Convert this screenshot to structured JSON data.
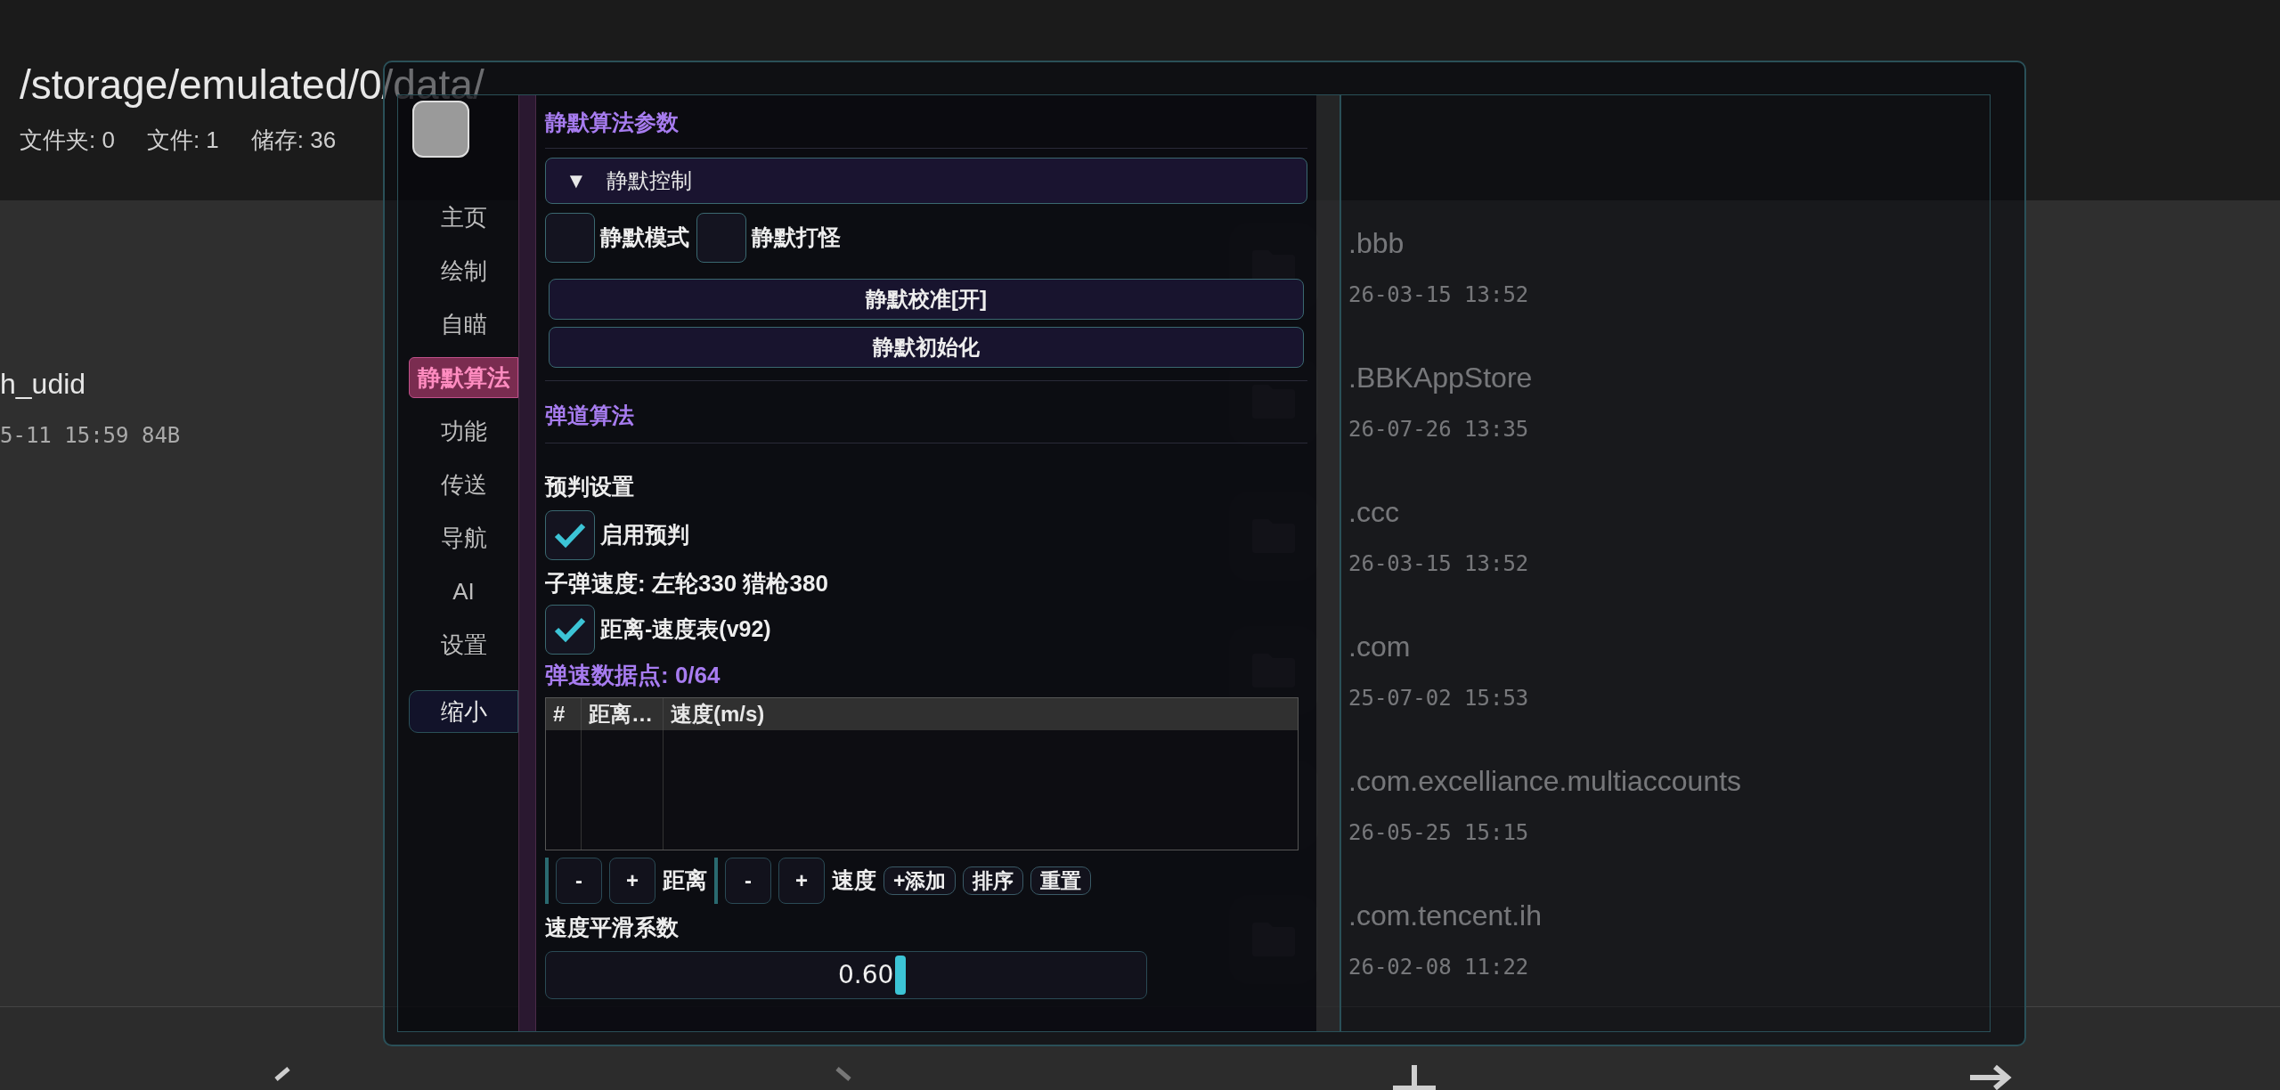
{
  "background": {
    "path": "/storage/emulated/0/data/",
    "stats": [
      "文件夹: 0",
      "文件: 1",
      "储存: 36"
    ],
    "left_item": {
      "name": "h_udid",
      "meta": "5-11 15:59 84B"
    },
    "files": [
      {
        "name": ".bbb",
        "date": "26-03-15 13:52"
      },
      {
        "name": ".BBKAppStore",
        "date": "26-07-26 13:35"
      },
      {
        "name": ".ccc",
        "date": "26-03-15 13:52"
      },
      {
        "name": ".com",
        "date": "25-07-02 15:53"
      },
      {
        "name": ".com.excelliance.multiaccounts",
        "date": "26-05-25 15:15"
      },
      {
        "name": ".com.tencent.ih",
        "date": "26-02-08 11:22"
      }
    ]
  },
  "menu": {
    "nav": [
      {
        "label": "主页",
        "selected": false
      },
      {
        "label": "绘制",
        "selected": false
      },
      {
        "label": "自瞄",
        "selected": false
      },
      {
        "label": "静默算法",
        "selected": true
      },
      {
        "label": "功能",
        "selected": false
      },
      {
        "label": "传送",
        "selected": false
      },
      {
        "label": "导航",
        "selected": false
      },
      {
        "label": "AI",
        "selected": false
      },
      {
        "label": "设置",
        "selected": false
      }
    ],
    "collapse_button": "缩小",
    "section_title": "静默算法参数",
    "group": {
      "marker": "▼",
      "label": "静默控制"
    },
    "toggles": [
      {
        "label": "静默模式",
        "checked": false
      },
      {
        "label": "静默打怪",
        "checked": false
      }
    ],
    "buttons": [
      "静默校准[开]",
      "静默初始化"
    ],
    "section2": "弹道算法",
    "prediction_heading": "预判设置",
    "enable": {
      "label": "启用预判",
      "checked": true
    },
    "speed_text": "子弹速度: 左轮330  猎枪380",
    "table_toggle": {
      "label": "距离-速度表(v92)",
      "checked": true
    },
    "data_points": "弹速数据点: 0/64",
    "table_columns": [
      "#",
      "距离…",
      "速度(m/s)"
    ],
    "controls": [
      {
        "kind": "step",
        "label": "-"
      },
      {
        "kind": "step",
        "label": "+"
      },
      {
        "kind": "text",
        "label": "距离"
      },
      {
        "kind": "step",
        "label": "-"
      },
      {
        "kind": "step",
        "label": "+"
      },
      {
        "kind": "text",
        "label": "速度"
      },
      {
        "kind": "pill",
        "label": "+添加"
      },
      {
        "kind": "pill",
        "label": "排序"
      },
      {
        "kind": "pill",
        "label": "重置"
      }
    ],
    "smoothing": {
      "label": "速度平滑系数",
      "value": "0.60",
      "level": 0.6
    }
  }
}
